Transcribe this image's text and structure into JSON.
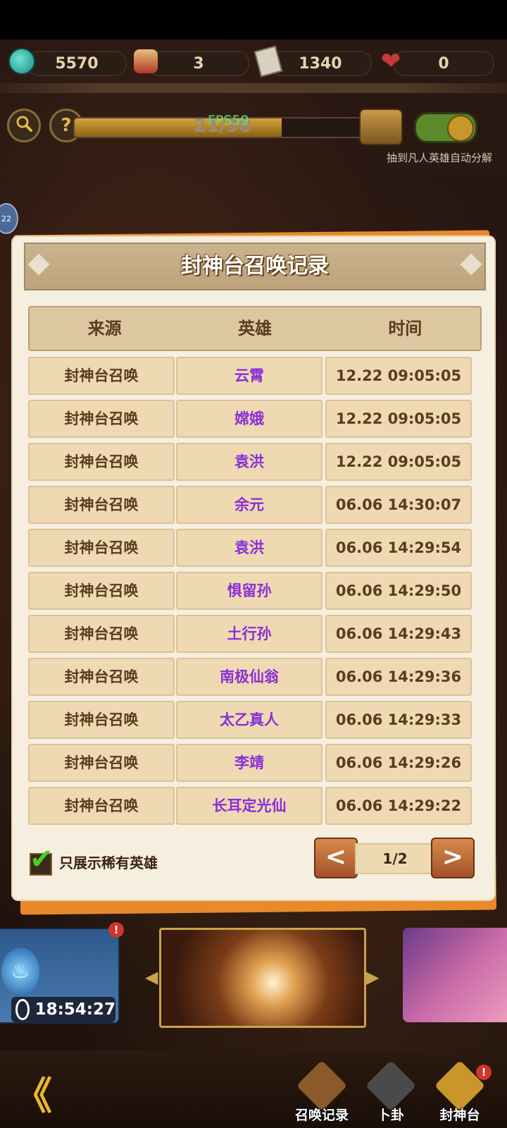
{
  "resources": [
    {
      "icon": "jade-coin-icon",
      "value": "5570"
    },
    {
      "icon": "god-figure-icon",
      "value": "3"
    },
    {
      "icon": "card-ticket-icon",
      "value": "1340"
    },
    {
      "icon": "heart-icon",
      "value": "0"
    }
  ],
  "toolbar": {
    "search_icon": "search-icon",
    "help_glyph": "?",
    "progress_text": "21/30",
    "progress_fraction": 0.7,
    "fps_text": "FPS59",
    "auto_decompose_label": "抽到凡人英雄自动分解",
    "side_badge": "22"
  },
  "modal": {
    "title": "封神台召唤记录",
    "headers": [
      "来源",
      "英雄",
      "时间"
    ],
    "rows": [
      {
        "source": "封神台召唤",
        "hero": "云霄",
        "time": "12.22 09:05:05"
      },
      {
        "source": "封神台召唤",
        "hero": "嫦娥",
        "time": "12.22 09:05:05"
      },
      {
        "source": "封神台召唤",
        "hero": "袁洪",
        "time": "12.22 09:05:05"
      },
      {
        "source": "封神台召唤",
        "hero": "余元",
        "time": "06.06 14:30:07"
      },
      {
        "source": "封神台召唤",
        "hero": "袁洪",
        "time": "06.06 14:29:54"
      },
      {
        "source": "封神台召唤",
        "hero": "惧留孙",
        "time": "06.06 14:29:50"
      },
      {
        "source": "封神台召唤",
        "hero": "土行孙",
        "time": "06.06 14:29:43"
      },
      {
        "source": "封神台召唤",
        "hero": "南极仙翁",
        "time": "06.06 14:29:36"
      },
      {
        "source": "封神台召唤",
        "hero": "太乙真人",
        "time": "06.06 14:29:33"
      },
      {
        "source": "封神台召唤",
        "hero": "李靖",
        "time": "06.06 14:29:26"
      },
      {
        "source": "封神台召唤",
        "hero": "长耳定光仙",
        "time": "06.06 14:29:22"
      }
    ],
    "filter_label": "只展示稀有英雄",
    "filter_checked": true,
    "pager": {
      "prev": "<",
      "next": ">",
      "page_text": "1/2"
    }
  },
  "carousel": {
    "timer": "18:54:27",
    "alert_glyph": "!"
  },
  "bottom_nav": [
    {
      "label": "召唤记录",
      "icon": "record-scroll-icon",
      "color": "#8a5a2a"
    },
    {
      "label": "卜卦",
      "icon": "yin-yang-icon",
      "color": "#4a4a4a"
    },
    {
      "label": "封神台",
      "icon": "fengshen-scroll-icon",
      "color": "#c9962c"
    }
  ],
  "colors": {
    "hero_text": "#8a2fd6",
    "modal_border": "#e88a2a",
    "check": "#4ccc22"
  }
}
